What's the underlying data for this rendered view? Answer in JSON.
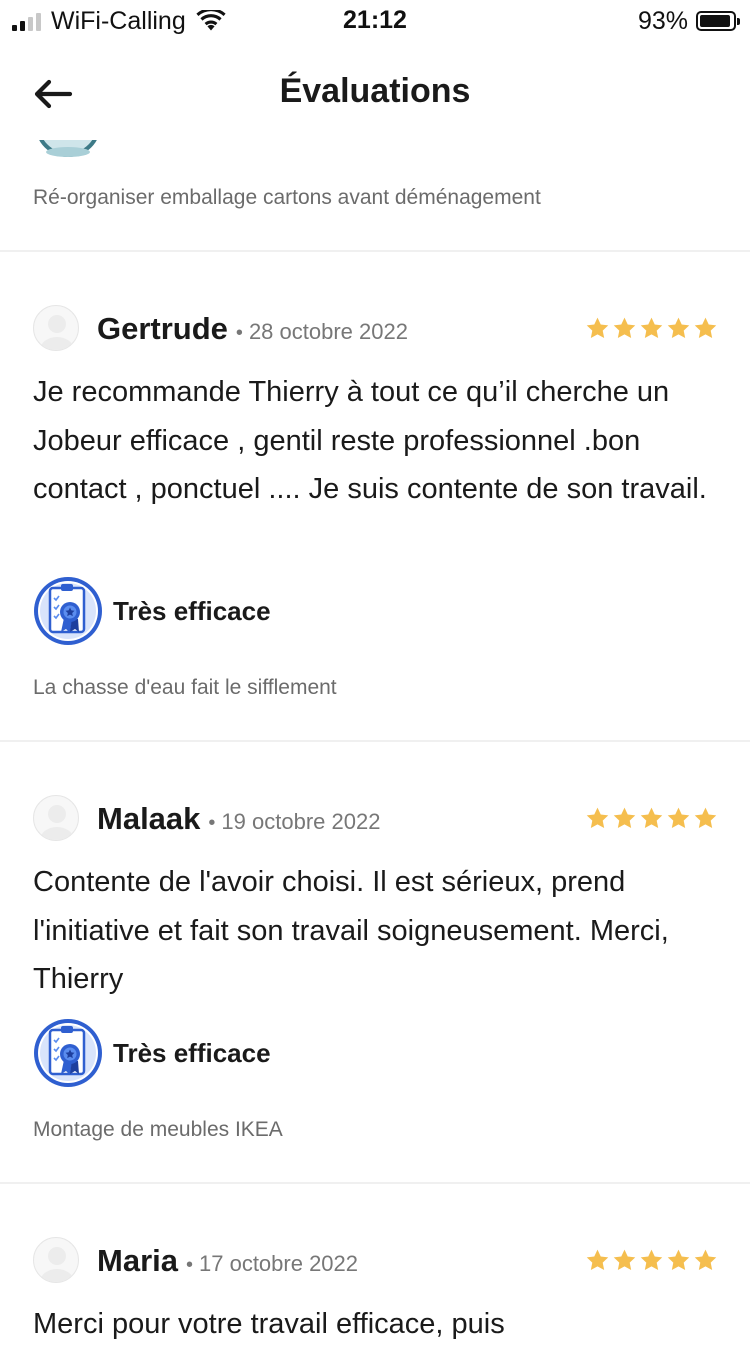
{
  "status_bar": {
    "carrier": "WiFi-Calling",
    "time": "21:12",
    "battery": "93%",
    "battery_level": 0.93
  },
  "header": {
    "title": "Évaluations",
    "back_icon": "arrow-left-icon"
  },
  "previous_review": {
    "task": "Ré-organiser emballage cartons avant déménagement"
  },
  "reviews": [
    {
      "name": "Gertrude",
      "separator": "•",
      "date": "28 octobre 2022",
      "rating": 5,
      "text": "Je recommande  Thierry à tout ce qu’il cherche un Jobeur efficace , gentil reste professionnel .bon contact , ponctuel .... Je suis contente de son travail.",
      "badge": "Très efficace",
      "task": "La chasse d'eau fait le sifflement"
    },
    {
      "name": "Malaak",
      "separator": "•",
      "date": "19 octobre 2022",
      "rating": 5,
      "text": "Contente de l'avoir choisi. Il est sérieux, prend l'initiative et fait son travail soigneusement. Merci, Thierry",
      "badge": "Très efficace",
      "task": "Montage de meubles IKEA"
    },
    {
      "name": "Maria",
      "separator": "•",
      "date": "17 octobre 2022",
      "rating": 5,
      "text": "Merci pour votre travail efficace, puis"
    }
  ],
  "colors": {
    "star": "#F5BE4E",
    "badge_blue": "#2F5FD0",
    "divider": "#F0F0F0",
    "muted_text": "#6B6B6B"
  }
}
